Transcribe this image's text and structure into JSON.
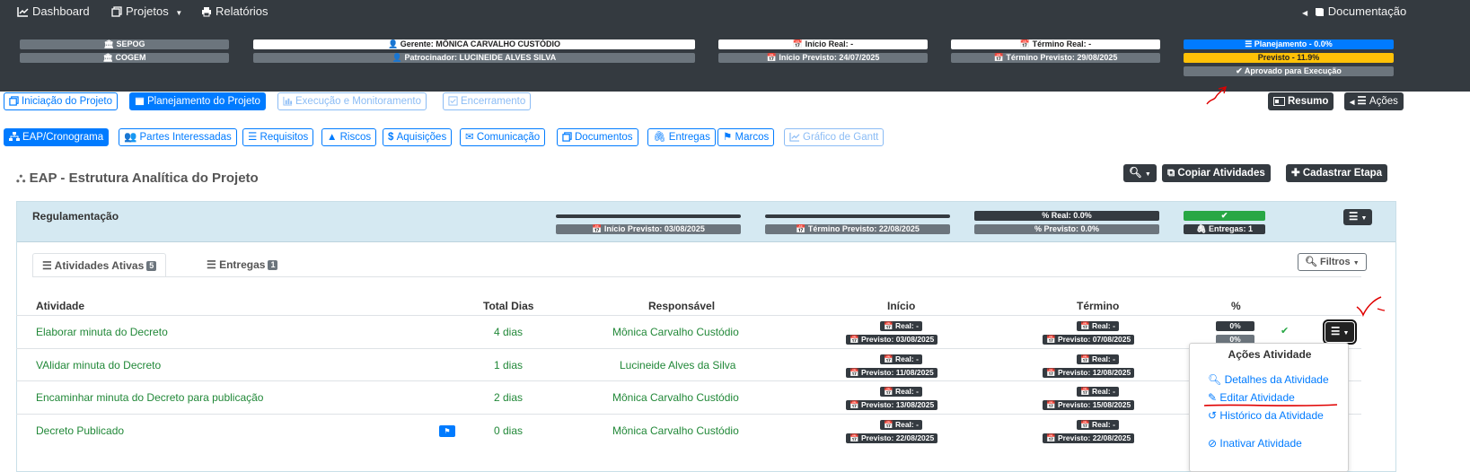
{
  "nav": {
    "dashboard": "Dashboard",
    "projetos": "Projetos",
    "relatorios": "Relatórios",
    "documentacao": "Documentação"
  },
  "info": {
    "sepog": "SEPOG",
    "cogem": "COGEM",
    "gerente": "Gerente: MÔNICA CARVALHO CUSTÓDIO",
    "patrocinador": "Patrocinador: LUCINEIDE ALVES SILVA",
    "inicio_real": "Início Real: -",
    "inicio_previsto": "Início Previsto: 24/07/2025",
    "termino_real": "Término Real: -",
    "termino_previsto": "Término Previsto: 29/08/2025",
    "planejamento": "Planejamento - 0.0%",
    "previsto": "Previsto - 11.9%",
    "aprovado": "Aprovado para Execução"
  },
  "phases": [
    "Iniciação do Projeto",
    "Planejamento do Projeto",
    "Execução e Monitoramento",
    "Encerramento"
  ],
  "active_phase": "Planejamento do Projeto",
  "right_buttons": {
    "resumo": "Resumo",
    "acoes": "Ações"
  },
  "subtabs": [
    "EAP/Cronograma",
    "Partes Interessadas",
    "Requisitos",
    "Riscos",
    "Aquisições",
    "Comunicação",
    "Documentos",
    "Entregas",
    "Marcos",
    "Gráfico de Gantt"
  ],
  "page_title": "EAP - Estrutura Analítica do Projeto",
  "toolbar": {
    "copiar": "Copiar Atividades",
    "cadastrar": "Cadastrar Etapa"
  },
  "stage": {
    "name": "Regulamentação",
    "inicio_previsto": "Início Previsto: 03/08/2025",
    "termino_previsto": "Término Previsto: 22/08/2025",
    "pct_real": "% Real: 0.0%",
    "pct_previsto": "% Previsto: 0.0%",
    "entregas": "Entregas: 1"
  },
  "tabs": {
    "ativas": "Atividades Ativas",
    "ativas_count": "5",
    "entregas": "Entregas",
    "entregas_count": "1",
    "filtros": "Filtros"
  },
  "table": {
    "headers": {
      "atividade": "Atividade",
      "total_dias": "Total Dias",
      "responsavel": "Responsável",
      "inicio": "Início",
      "termino": "Término",
      "pct": "%"
    },
    "rows": [
      {
        "atividade": "Elaborar minuta do Decreto",
        "dias": "4 dias",
        "responsavel": "Mônica Carvalho Custódio",
        "inicio_real": "Real: -",
        "inicio_prev": "Previsto: 03/08/2025",
        "termino_real": "Real: -",
        "termino_prev": "Previsto: 07/08/2025",
        "pct_real": "0%",
        "pct_prev": "0%"
      },
      {
        "atividade": "VAlidar minuta do Decreto",
        "dias": "1 dias",
        "responsavel": "Lucineide Alves da Silva",
        "inicio_real": "Real: -",
        "inicio_prev": "Previsto: 11/08/2025",
        "termino_real": "Real: -",
        "termino_prev": "Previsto: 12/08/2025"
      },
      {
        "atividade": "Encaminhar minuta do Decreto para publicação",
        "dias": "2 dias",
        "responsavel": "Mônica Carvalho Custódio",
        "inicio_real": "Real: -",
        "inicio_prev": "Previsto: 13/08/2025",
        "termino_real": "Real: -",
        "termino_prev": "Previsto: 15/08/2025"
      },
      {
        "atividade": "Decreto Publicado",
        "dias": "0 dias",
        "responsavel": "Mônica Carvalho Custódio",
        "inicio_real": "Real: -",
        "inicio_prev": "Previsto: 22/08/2025",
        "termino_real": "Real: -",
        "termino_prev": "Previsto: 22/08/2025"
      }
    ]
  },
  "menu": {
    "title": "Ações Atividade",
    "detalhes": "Detalhes da Atividade",
    "editar": "Editar Atividade",
    "historico": "Histórico da Atividade",
    "inativar": "Inativar Atividade"
  },
  "colors": {
    "navbar": "#343a40",
    "primary": "#007bff",
    "success": "#28a745",
    "warning": "#ffc107",
    "secondary": "#6c757d",
    "annotation": "#e00000"
  }
}
